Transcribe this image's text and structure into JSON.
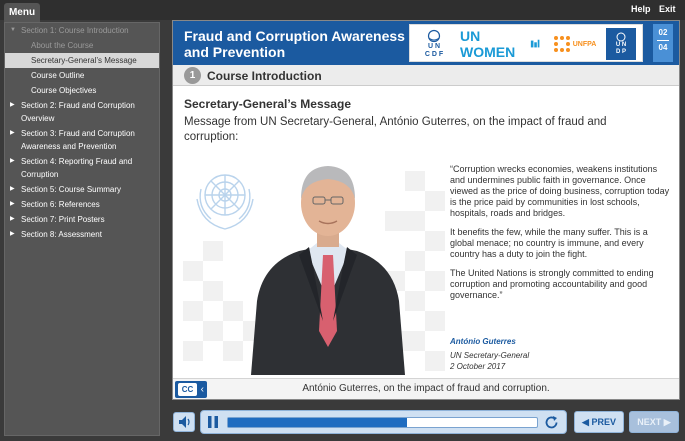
{
  "topbar": {
    "menu_label": "Menu",
    "help_label": "Help",
    "exit_label": "Exit"
  },
  "sidebar": {
    "items": [
      {
        "label": "Section 1: Course Introduction",
        "level": 0,
        "state": "dim",
        "arrow": "▼"
      },
      {
        "label": "About the Course",
        "level": 1,
        "state": "dim"
      },
      {
        "label": "Secretary-General’s Message",
        "level": 1,
        "state": "active"
      },
      {
        "label": "Course Outline",
        "level": 1,
        "state": "normal"
      },
      {
        "label": "Course Objectives",
        "level": 1,
        "state": "normal"
      },
      {
        "label": "Section 2: Fraud and Corruption Overview",
        "level": 0,
        "state": "normal",
        "arrow": "▶"
      },
      {
        "label": "Section 3: Fraud and Corruption Awareness and Prevention",
        "level": 0,
        "state": "normal",
        "arrow": "▶"
      },
      {
        "label": "Section 4: Reporting Fraud and Corruption",
        "level": 0,
        "state": "normal",
        "arrow": "▶"
      },
      {
        "label": "Section 5: Course Summary",
        "level": 0,
        "state": "normal",
        "arrow": "▶"
      },
      {
        "label": "Section 6: References",
        "level": 0,
        "state": "normal",
        "arrow": "▶"
      },
      {
        "label": "Section 7: Print Posters",
        "level": 0,
        "state": "normal",
        "arrow": "▶"
      },
      {
        "label": "Section 8: Assessment",
        "level": 0,
        "state": "normal",
        "arrow": "▶"
      }
    ]
  },
  "header": {
    "title": "Fraud and Corruption Awareness and Prevention",
    "logos": {
      "uncdf_line1": "U N",
      "uncdf_line2": "C D F",
      "unwomen": "UN WOMEN",
      "unfpa": "UNFPA",
      "undp_line1": "U N",
      "undp_line2": "D P"
    },
    "page_current": "02",
    "page_total": "04"
  },
  "section": {
    "number": "1",
    "title": "Course Introduction"
  },
  "content": {
    "heading": "Secretary-General’s Message",
    "intro": "Message from UN Secretary-General, António Guterres, on the impact of fraud and corruption:",
    "quote_paragraphs": [
      "“Corruption wrecks economies, weakens institutions and undermines public faith in governance. Once viewed as the price of doing business, corruption today is the price paid by communities in lost schools, hospitals, roads and bridges.",
      "It benefits the few, while the many suffer. This is a global menace; no country is immune, and every country has a duty to join the fight.",
      "The United Nations is strongly committed to ending corruption and promoting accountability and good governance.”"
    ],
    "signature_name": "António Guterres",
    "signature_role": "UN Secretary-General",
    "signature_date": "2 October 2017"
  },
  "caption": {
    "cc_label": "CC",
    "cc_chevron": "‹",
    "text": "António Guterres, on the impact of fraud and corruption."
  },
  "player": {
    "progress": 0.58
  },
  "nav": {
    "prev_label": "◀ PREV",
    "next_label": "NEXT ▶"
  },
  "colors": {
    "brand_blue": "#1b5aa0",
    "sidebar_bg": "#555555",
    "unwomen_blue": "#1a9ad6",
    "unfpa_orange": "#f7901e"
  }
}
